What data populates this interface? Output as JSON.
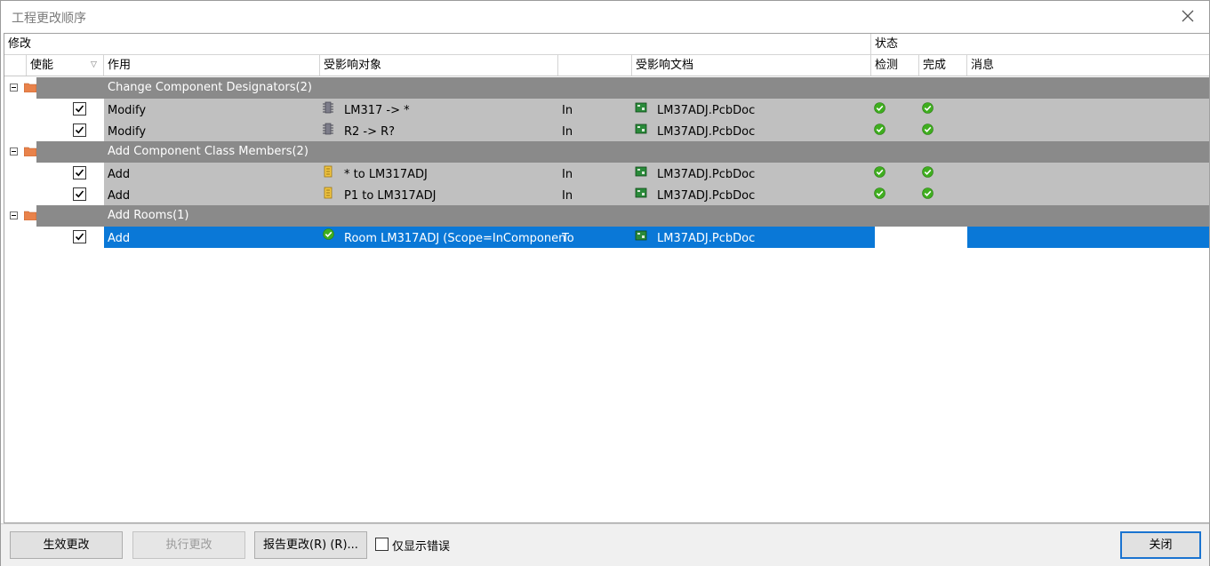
{
  "window": {
    "title": "工程更改顺序"
  },
  "header": {
    "group_modify": "修改",
    "group_status": "状态",
    "col_enable": "使能",
    "col_action": "作用",
    "col_affected_object": "受影响对象",
    "col_affected_doc": "受影响文档",
    "col_check": "检测",
    "col_done": "完成",
    "col_message": "消息"
  },
  "groups": [
    {
      "label": "Change Component Designators(2)"
    },
    {
      "label": "Add Component Class Members(2)"
    },
    {
      "label": "Add Rooms(1)"
    }
  ],
  "rows": [
    {
      "action": "Modify",
      "object": "LM317 -> *",
      "dir": "In",
      "doc": "LM37ADJ.PcbDoc",
      "object_icon": "component-chip-icon"
    },
    {
      "action": "Modify",
      "object": "R2 -> R?",
      "dir": "In",
      "doc": "LM37ADJ.PcbDoc",
      "object_icon": "component-chip-icon"
    },
    {
      "action": "Add",
      "object": "* to LM317ADJ",
      "dir": "In",
      "doc": "LM37ADJ.PcbDoc",
      "object_icon": "class-member-icon"
    },
    {
      "action": "Add",
      "object": "P1 to LM317ADJ",
      "dir": "In",
      "doc": "LM37ADJ.PcbDoc",
      "object_icon": "class-member-icon"
    },
    {
      "action": "Add",
      "object": "Room LM317ADJ (Scope=InComponen",
      "dir": "To",
      "doc": "LM37ADJ.PcbDoc",
      "object_icon": "room-check-icon"
    }
  ],
  "buttons": {
    "validate": "生效更改",
    "execute": "执行更改",
    "report": "报告更改(R) (R)...",
    "show_errors": "仅显示错误",
    "close": "关闭"
  },
  "colors": {
    "group_bar": "#8a8a8a",
    "row_bg": "#c0c0c0",
    "selection": "#0a78d7",
    "ok_green": "#3fae1f"
  }
}
